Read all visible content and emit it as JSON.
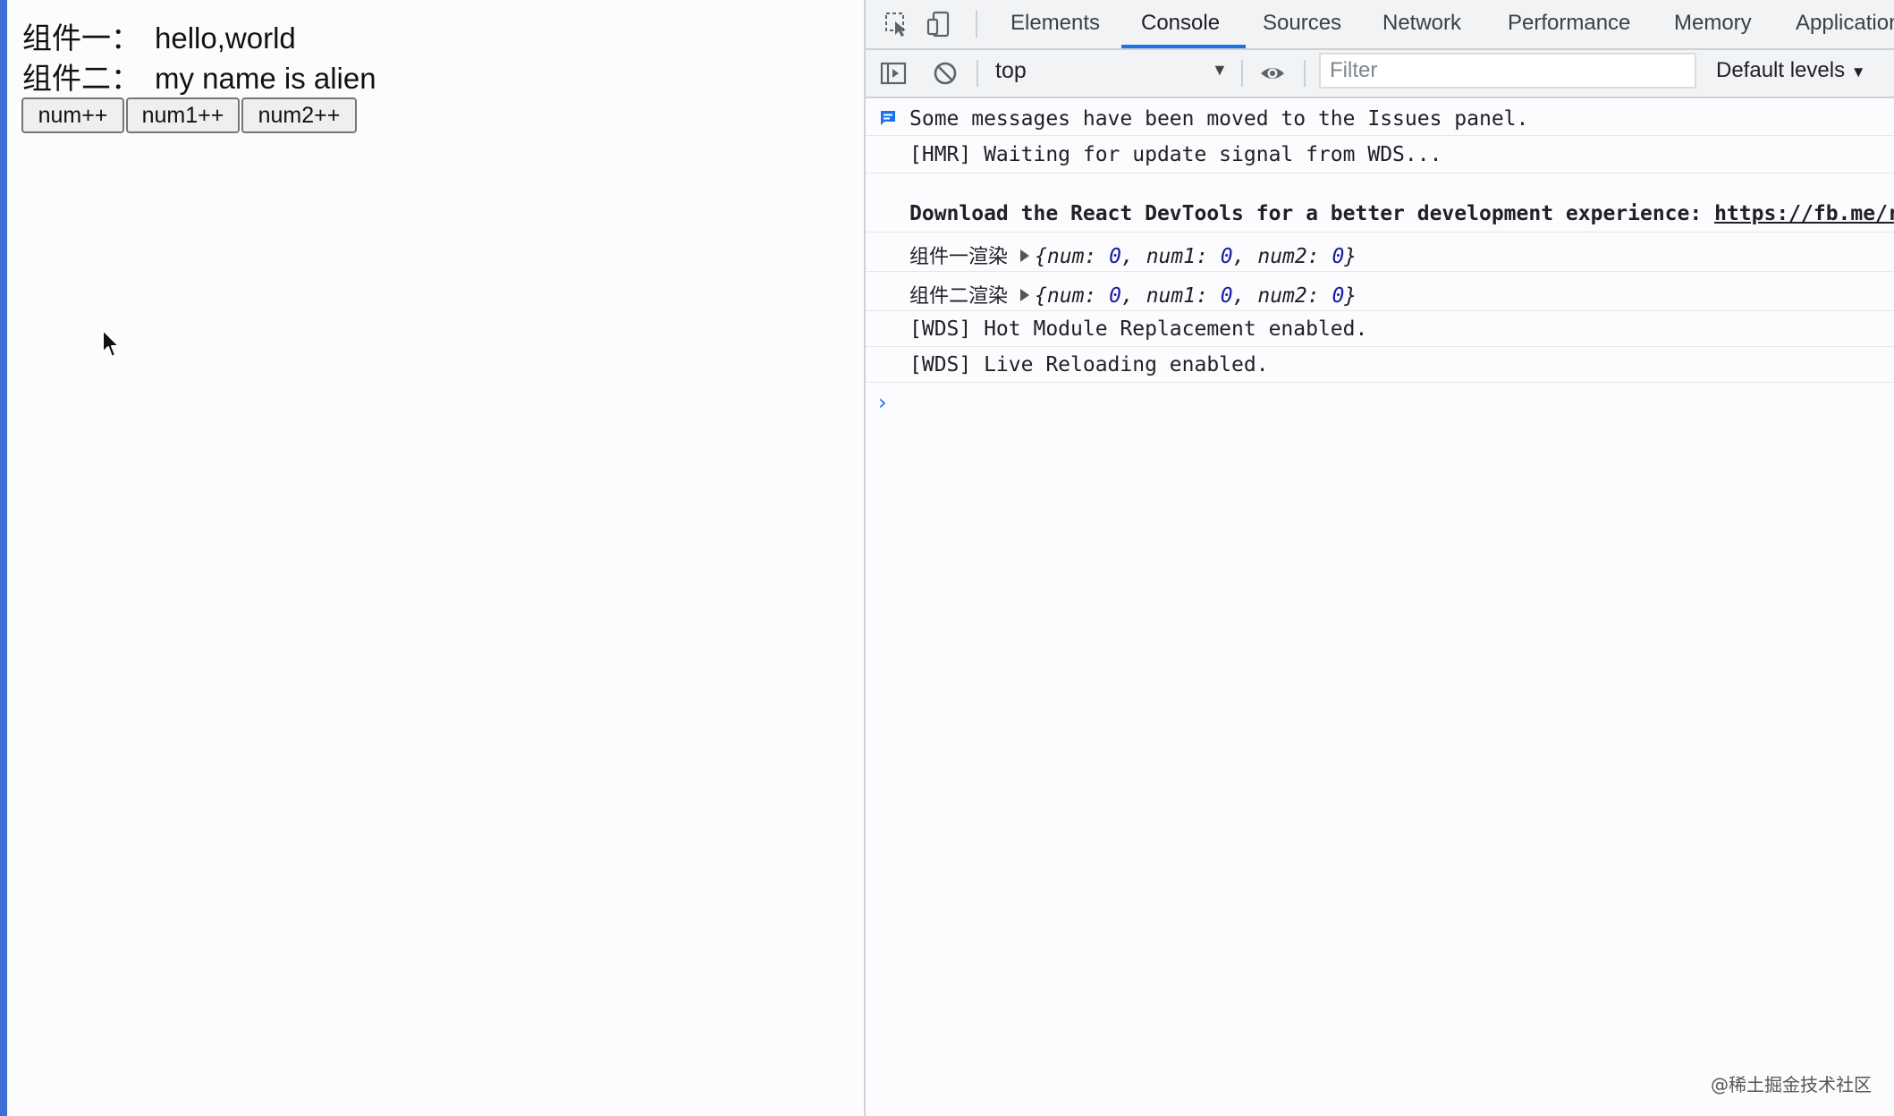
{
  "page": {
    "line1": {
      "label": "组件一：",
      "value": "hello,world"
    },
    "line2": {
      "label": "组件二：",
      "value": "my name is alien"
    },
    "buttons": [
      "num++",
      "num1++",
      "num2++"
    ]
  },
  "devtools": {
    "tabs": [
      "Elements",
      "Console",
      "Sources",
      "Network",
      "Performance",
      "Memory",
      "Application"
    ],
    "active_tab": "Console",
    "toolbar": {
      "context": "top",
      "filter_placeholder": "Filter",
      "levels": "Default levels"
    },
    "messages": {
      "issues": "Some messages have been moved to the Issues panel.",
      "hmr": "[HMR] Waiting for update signal from WDS...",
      "react_text": "Download the React DevTools for a better development experience: ",
      "react_link": "https://fb.me/react-devtools",
      "log1_label": "组件一渲染",
      "log2_label": "组件二渲染",
      "obj": {
        "k0": "num",
        "v0": "0",
        "k1": "num1",
        "v1": "0",
        "k2": "num2",
        "v2": "0"
      },
      "wds1": "[WDS] Hot Module Replacement enabled.",
      "wds2": "[WDS] Live Reloading enabled."
    }
  },
  "watermark": "@稀土掘金技术社区",
  "colors": {
    "accent": "#1a73e8",
    "number": "#1a1aa6",
    "edge": "#3f6fd6"
  }
}
